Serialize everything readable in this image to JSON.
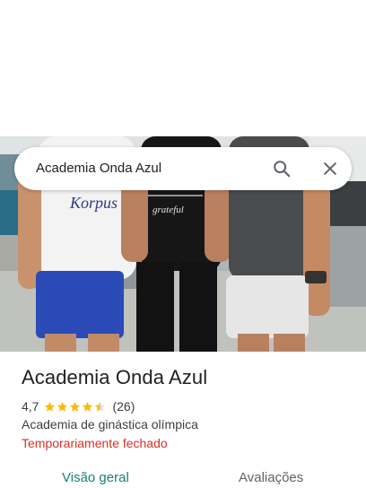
{
  "search": {
    "query": "Academia Onda Azul",
    "search_icon": "search-icon",
    "close_icon": "close-icon"
  },
  "photo": {
    "shirt_text": "Korpus",
    "shirt_text_2": "grateful"
  },
  "place": {
    "name": "Academia Onda Azul",
    "rating": "4,7",
    "review_count": "(26)",
    "stars_filled": 4.5,
    "category": "Academia de ginástica olímpica",
    "status": "Temporariamente fechado"
  },
  "tabs": [
    {
      "label": "Visão geral",
      "active": true
    },
    {
      "label": "Avaliações",
      "active": false
    }
  ],
  "colors": {
    "star": "#fbbc04",
    "status": "#d93025",
    "active_tab": "#1a7e7a"
  }
}
